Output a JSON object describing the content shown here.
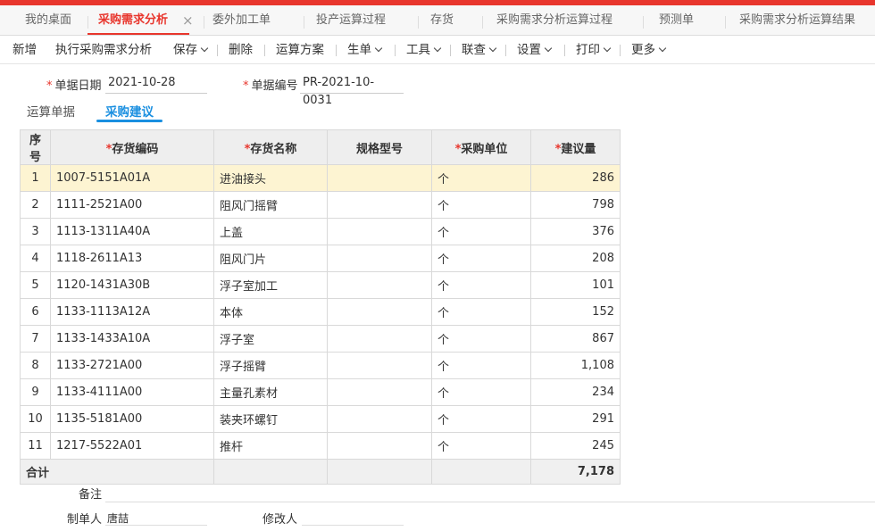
{
  "tabs": [
    {
      "label": "我的桌面"
    },
    {
      "label": "采购需求分析"
    },
    {
      "label": "委外加工单"
    },
    {
      "label": "投产运算过程"
    },
    {
      "label": "存货"
    },
    {
      "label": "采购需求分析运算过程"
    },
    {
      "label": "预测单"
    },
    {
      "label": "采购需求分析运算结果"
    }
  ],
  "close_glyph": "×",
  "toolbar": {
    "add": "新增",
    "run": "执行采购需求分析",
    "save": "保存",
    "delete": "删除",
    "plan": "运算方案",
    "generate": "生单",
    "tools": "工具",
    "query": "联查",
    "settings": "设置",
    "print": "打印",
    "more": "更多"
  },
  "form": {
    "date_label": "单据日期",
    "date_value": "2021-10-28",
    "code_label": "单据编号",
    "code_value": "PR-2021-10-0031",
    "required_mark": "*"
  },
  "subtabs": {
    "calc": "运算单据",
    "suggest": "采购建议"
  },
  "table": {
    "headers": {
      "seq": "序号",
      "code": "存货编码",
      "name": "存货名称",
      "spec": "规格型号",
      "unit": "采购单位",
      "qty": "建议量"
    },
    "rows": [
      {
        "seq": "1",
        "code": "1007-5151A01A",
        "name": "进油接头",
        "spec": "",
        "unit": "个",
        "qty": "286"
      },
      {
        "seq": "2",
        "code": "1111-2521A00",
        "name": "阻风门摇臂",
        "spec": "",
        "unit": "个",
        "qty": "798"
      },
      {
        "seq": "3",
        "code": "1113-1311A40A",
        "name": "上盖",
        "spec": "",
        "unit": "个",
        "qty": "376"
      },
      {
        "seq": "4",
        "code": "1118-2611A13",
        "name": "阻风门片",
        "spec": "",
        "unit": "个",
        "qty": "208"
      },
      {
        "seq": "5",
        "code": "1120-1431A30B",
        "name": "浮子室加工",
        "spec": "",
        "unit": "个",
        "qty": "101"
      },
      {
        "seq": "6",
        "code": "1133-1113A12A",
        "name": "本体",
        "spec": "",
        "unit": "个",
        "qty": "152"
      },
      {
        "seq": "7",
        "code": "1133-1433A10A",
        "name": "浮子室",
        "spec": "",
        "unit": "个",
        "qty": "867"
      },
      {
        "seq": "8",
        "code": "1133-2721A00",
        "name": "浮子摇臂",
        "spec": "",
        "unit": "个",
        "qty": "1,108"
      },
      {
        "seq": "9",
        "code": "1133-4111A00",
        "name": "主量孔素材",
        "spec": "",
        "unit": "个",
        "qty": "234"
      },
      {
        "seq": "10",
        "code": "1135-5181A00",
        "name": "装夹环螺钉",
        "spec": "",
        "unit": "个",
        "qty": "291"
      },
      {
        "seq": "11",
        "code": "1217-5522A01",
        "name": "推杆",
        "spec": "",
        "unit": "个",
        "qty": "245"
      }
    ],
    "total_label": "合计",
    "total_qty": "7,178"
  },
  "footer": {
    "remark_label": "备注",
    "maker_label": "制单人",
    "maker_value": "唐喆",
    "modifier_label": "修改人"
  },
  "colors": {
    "accent_red": "#e8362d",
    "accent_blue": "#1a8fe0",
    "selected_row": "#fdf4d2"
  }
}
